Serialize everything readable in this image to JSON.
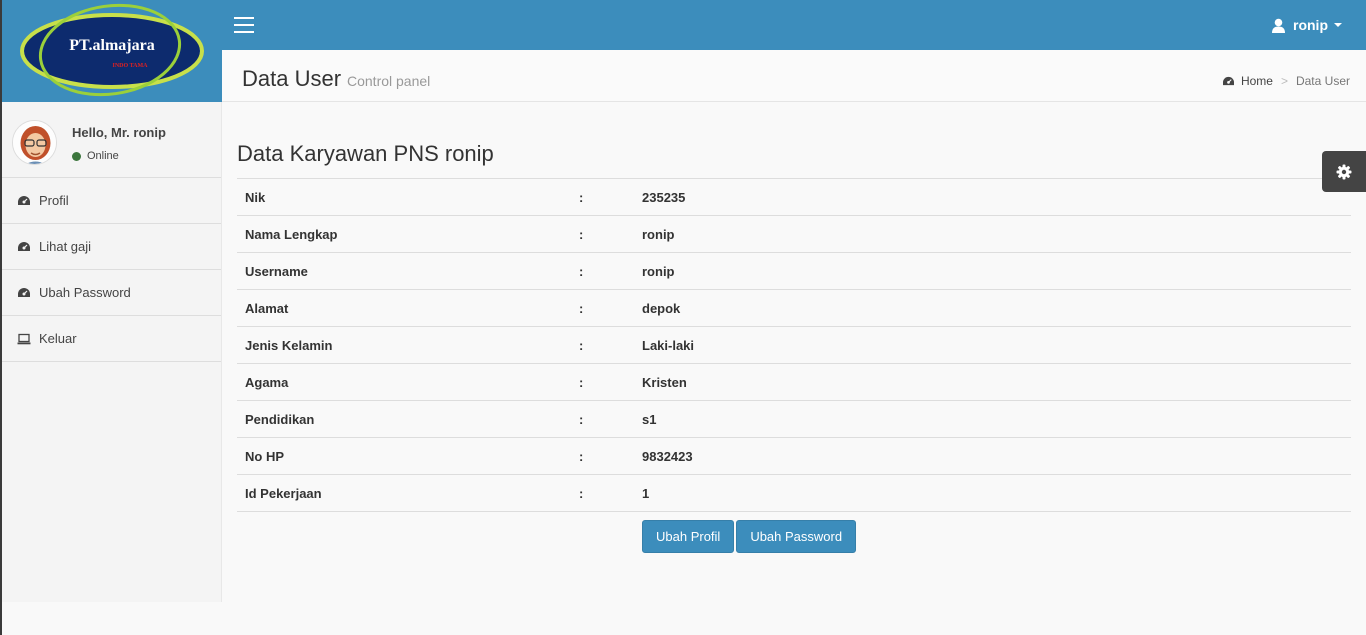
{
  "logo": {
    "brand": "PT.almajara",
    "tagline": "INDO TAMA"
  },
  "header": {
    "user_name": "ronip"
  },
  "sidebar": {
    "greeting": "Hello, Mr. ronip",
    "status": "Online",
    "items": [
      {
        "label": "Profil",
        "icon": "dashboard-icon"
      },
      {
        "label": "Lihat gaji",
        "icon": "dashboard-icon"
      },
      {
        "label": "Ubah Password",
        "icon": "dashboard-icon"
      },
      {
        "label": "Keluar",
        "icon": "laptop-icon"
      }
    ]
  },
  "content_header": {
    "title": "Data User",
    "subtitle": "Control panel",
    "breadcrumb": {
      "home": "Home",
      "current": "Data User",
      "separator": ">"
    }
  },
  "section": {
    "title": "Data Karyawan PNS ronip"
  },
  "table": {
    "separator": ":",
    "rows": [
      {
        "label": "Nik",
        "value": "235235"
      },
      {
        "label": "Nama Lengkap",
        "value": "ronip"
      },
      {
        "label": "Username",
        "value": "ronip"
      },
      {
        "label": "Alamat",
        "value": "depok"
      },
      {
        "label": "Jenis Kelamin",
        "value": "Laki-laki"
      },
      {
        "label": "Agama",
        "value": "Kristen"
      },
      {
        "label": "Pendidikan",
        "value": "s1"
      },
      {
        "label": "No HP",
        "value": "9832423"
      },
      {
        "label": "Id Pekerjaan",
        "value": "1"
      }
    ]
  },
  "buttons": {
    "edit_profile": "Ubah Profil",
    "change_password": "Ubah Password"
  },
  "colors": {
    "primary": "#3c8dbc",
    "online": "#3c763d",
    "settings_tab": "#444444"
  }
}
